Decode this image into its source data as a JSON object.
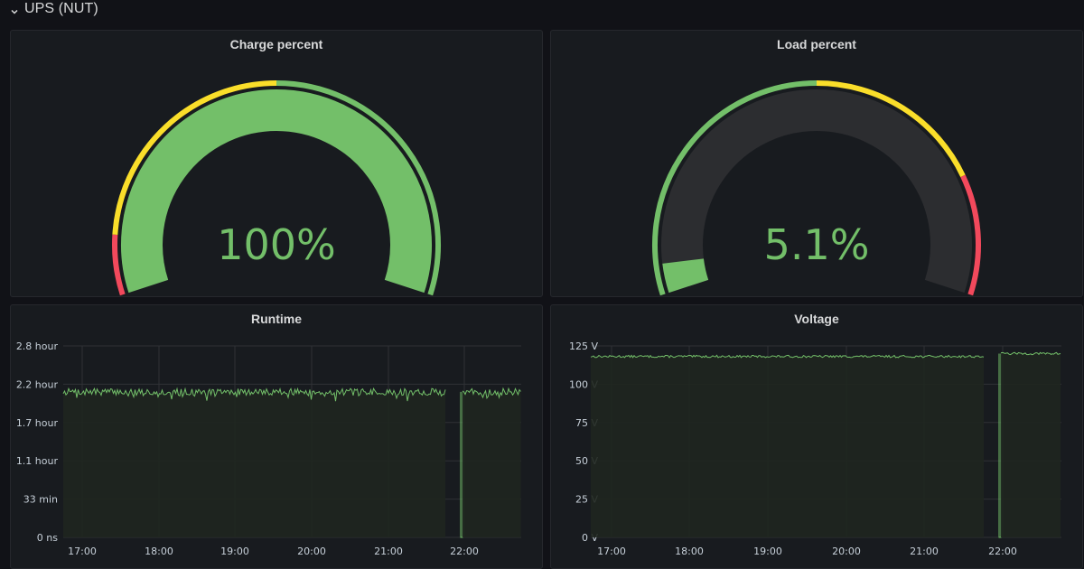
{
  "row": {
    "title": "UPS (NUT)",
    "icon": "chevron-down-icon"
  },
  "colors": {
    "green": "#73bf69",
    "yellow": "#fade2a",
    "red": "#f2495c",
    "track": "#2c2d30",
    "series_fill": "#1f261f",
    "grid": "#2f3236"
  },
  "panels": {
    "charge": {
      "title": "Charge percent",
      "value": 100,
      "display": "100%",
      "min": 0,
      "max": 100,
      "thresholds": [
        {
          "from": 0,
          "to": 10,
          "color": "red"
        },
        {
          "from": 10,
          "to": 50,
          "color": "yellow"
        },
        {
          "from": 50,
          "to": 100,
          "color": "green"
        }
      ]
    },
    "load": {
      "title": "Load percent",
      "value": 5.1,
      "display": "5.1%",
      "min": 0,
      "max": 100,
      "thresholds": [
        {
          "from": 0,
          "to": 50,
          "color": "green"
        },
        {
          "from": 50,
          "to": 80,
          "color": "yellow"
        },
        {
          "from": 80,
          "to": 100,
          "color": "red"
        }
      ]
    },
    "runtime": {
      "title": "Runtime",
      "y_ticks": [
        "2.8 hour",
        "2.2 hour",
        "1.7 hour",
        "1.1 hour",
        "33 min",
        "0 ns"
      ],
      "x_ticks": [
        "17:00",
        "18:00",
        "19:00",
        "20:00",
        "21:00",
        "22:00"
      ]
    },
    "voltage": {
      "title": "Voltage",
      "y_ticks": [
        "125 V",
        "100 V",
        "75 V",
        "50 V",
        "25 V",
        "0 V"
      ],
      "x_ticks": [
        "17:00",
        "18:00",
        "19:00",
        "20:00",
        "21:00",
        "22:00"
      ]
    }
  },
  "chart_data": [
    {
      "type": "line",
      "title": "Runtime",
      "x_range": [
        "16:45",
        "22:45"
      ],
      "ylim_hours": [
        0,
        2.8
      ],
      "segments": [
        {
          "from": "16:45",
          "to": "21:45",
          "approx_value_hours": 2.1,
          "noise_hours": 0.12
        },
        {
          "from": "21:45",
          "to": "21:57",
          "gap": true
        },
        {
          "from": "21:57",
          "to": "21:58",
          "approx_value_hours": 0
        },
        {
          "from": "21:58",
          "to": "22:45",
          "approx_value_hours": 2.1,
          "noise_hours": 0.12
        }
      ]
    },
    {
      "type": "line",
      "title": "Voltage",
      "x_range": [
        "16:45",
        "22:45"
      ],
      "ylim_volts": [
        0,
        125
      ],
      "segments": [
        {
          "from": "16:45",
          "to": "21:47",
          "approx_value_volts": 118,
          "noise_volts": 1.2
        },
        {
          "from": "21:47",
          "to": "21:59",
          "gap": true
        },
        {
          "from": "21:59",
          "to": "22:00",
          "approx_value_volts": 0
        },
        {
          "from": "22:00",
          "to": "22:45",
          "approx_value_volts": 120,
          "noise_volts": 0.6
        }
      ]
    }
  ]
}
